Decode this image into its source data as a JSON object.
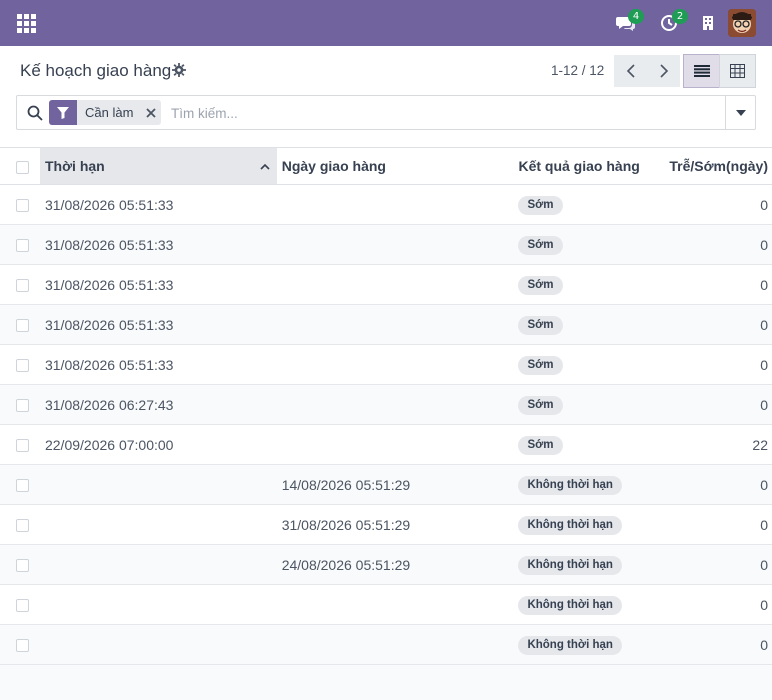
{
  "navbar": {
    "messages_badge": "4",
    "activities_badge": "2"
  },
  "control": {
    "title": "Kế hoạch giao hàng",
    "pager_value": "1-12 / 12"
  },
  "search": {
    "facet_label": "Cần làm",
    "placeholder": "Tìm kiếm..."
  },
  "table": {
    "columns": [
      "Thời hạn",
      "Ngày giao hàng",
      "Kết quả giao hàng",
      "Trễ/Sớm(ngày)"
    ],
    "rows": [
      {
        "deadline": "31/08/2026 05:51:33",
        "delivery_date": "",
        "result": "Sớm",
        "delay": "0"
      },
      {
        "deadline": "31/08/2026 05:51:33",
        "delivery_date": "",
        "result": "Sớm",
        "delay": "0"
      },
      {
        "deadline": "31/08/2026 05:51:33",
        "delivery_date": "",
        "result": "Sớm",
        "delay": "0"
      },
      {
        "deadline": "31/08/2026 05:51:33",
        "delivery_date": "",
        "result": "Sớm",
        "delay": "0"
      },
      {
        "deadline": "31/08/2026 05:51:33",
        "delivery_date": "",
        "result": "Sớm",
        "delay": "0"
      },
      {
        "deadline": "31/08/2026 06:27:43",
        "delivery_date": "",
        "result": "Sớm",
        "delay": "0"
      },
      {
        "deadline": "22/09/2026 07:00:00",
        "delivery_date": "",
        "result": "Sớm",
        "delay": "22"
      },
      {
        "deadline": "",
        "delivery_date": "14/08/2026 05:51:29",
        "result": "Không thời hạn",
        "delay": "0"
      },
      {
        "deadline": "",
        "delivery_date": "31/08/2026 05:51:29",
        "result": "Không thời hạn",
        "delay": "0"
      },
      {
        "deadline": "",
        "delivery_date": "24/08/2026 05:51:29",
        "result": "Không thời hạn",
        "delay": "0"
      },
      {
        "deadline": "",
        "delivery_date": "",
        "result": "Không thời hạn",
        "delay": "0"
      },
      {
        "deadline": "",
        "delivery_date": "",
        "result": "Không thời hạn",
        "delay": "0"
      }
    ]
  },
  "colors": {
    "brand": "#71639e",
    "badge": "#1f9d55"
  },
  "icons": [
    "apps-grid-icon",
    "chat-icon",
    "activity-clock-icon",
    "company-building-icon",
    "gear-icon",
    "chevron-left-icon",
    "chevron-right-icon",
    "list-view-icon",
    "pivot-grid-icon",
    "search-icon",
    "filter-icon",
    "close-icon",
    "caret-down-icon",
    "sort-up-icon"
  ]
}
